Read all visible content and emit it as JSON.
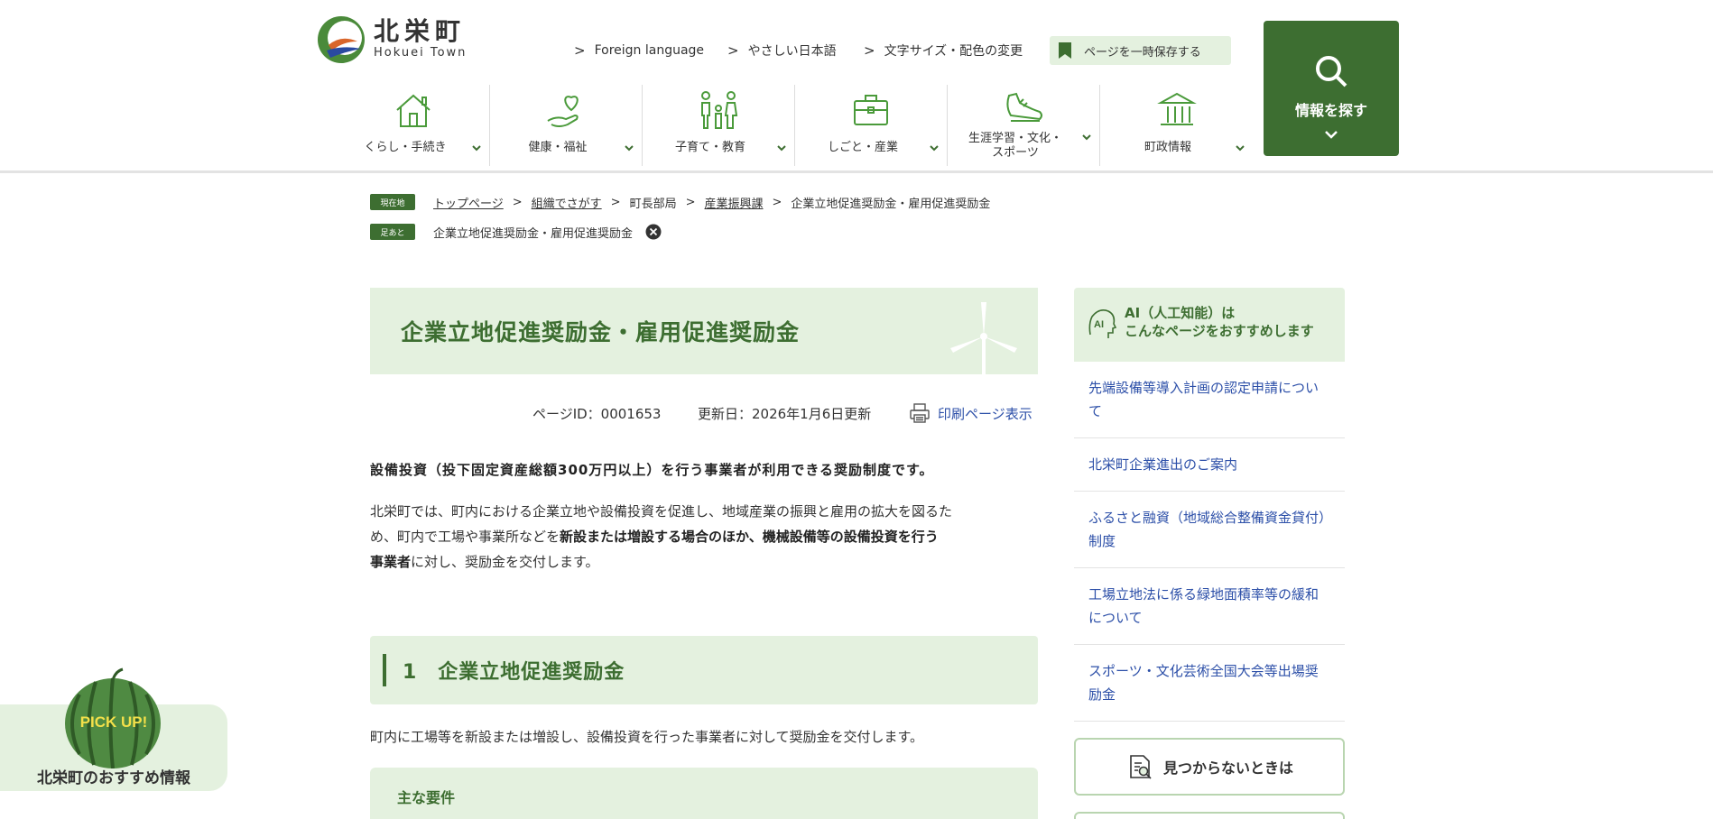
{
  "header": {
    "logo_jp": "北栄町",
    "logo_en": "Hokuei Town",
    "util_links": [
      "Foreign language",
      "やさしい日本語",
      "文字サイズ・配色の変更"
    ],
    "save_label": "ページを一時保存する",
    "search_label": "情報を探す",
    "nav": [
      {
        "label": "くらし・手続き",
        "icon": "house-icon"
      },
      {
        "label": "健康・福祉",
        "icon": "heart-hand-icon"
      },
      {
        "label": "子育て・教育",
        "icon": "family-icon"
      },
      {
        "label": "しごと・産業",
        "icon": "briefcase-icon"
      },
      {
        "label_1": "生涯学習・文化・",
        "label_2": "スポーツ",
        "icon": "shoe-icon"
      },
      {
        "label": "町政情報",
        "icon": "townhall-icon"
      }
    ]
  },
  "breadcrumb": {
    "current_tag": "現在地",
    "items": [
      "トップページ",
      "組織でさがす",
      "町長部局",
      "産業振興課",
      "企業立地促進奨励金・雇用促進奨励金"
    ],
    "footprint_tag": "足あと",
    "footprint_item": "企業立地促進奨励金・雇用促進奨励金"
  },
  "main": {
    "title": "企業立地促進奨励金・雇用促進奨励金",
    "page_id": "ページID：0001653",
    "updated": "更新日：2026年1月6日更新",
    "print_label": "印刷ページ表示",
    "lead": "設備投資（投下固定資産総額300万円以上）を行う事業者が利用できる奨励制度です。",
    "para_1": "北栄町では、町内における企業立地や設備投資を促進し、地域産業の振興と雇用の拡大を図るた",
    "para_2a": "め、町内で工場や事業所などを",
    "para_2b": "新設または増設する場合のほか、機械設備等の設備投資を行う",
    "para_3a": "事業者",
    "para_3b": "に対し、奨励金を交付します。",
    "section_1_title": "1　企業立地促進奨励金",
    "section_1_text": "町内に工場等を新設または増設し、設備投資を行った事業者に対して奨励金を交付します。",
    "subsection_title": "主な要件"
  },
  "sidebar": {
    "ai_title_1": "AI（人工知能）は",
    "ai_title_2": "こんなページをおすすめします",
    "ai_badge": "AI",
    "links": [
      "先端設備等導入計画の認定申請について",
      "北栄町企業進出のご案内",
      "ふるさと融資（地域総合整備資金貸付）制度",
      "工場立地法に係る緑地面積率等の緩和について",
      "スポーツ・文化芸術全国大会等出場奨励金"
    ],
    "not_found": "見つからないときは"
  },
  "pickup": {
    "badge": "PICK UP!",
    "label": "北栄町のおすすめ情報"
  },
  "colors": {
    "brand_green": "#3d6e31",
    "light_green": "#e4f1df",
    "link_blue": "#2c4fa8"
  }
}
